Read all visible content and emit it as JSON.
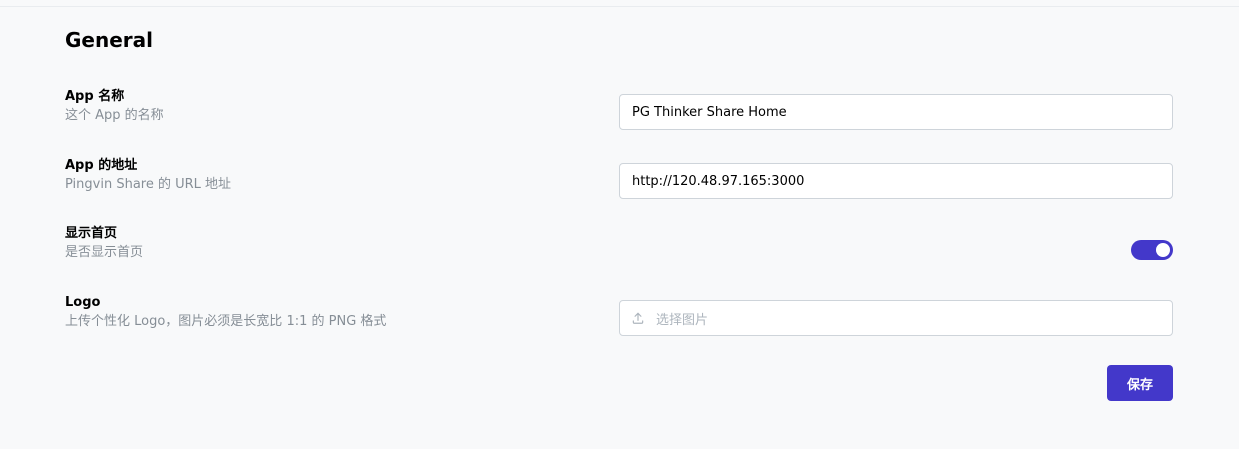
{
  "section": {
    "title": "General"
  },
  "settings": [
    {
      "title": "App 名称",
      "description": "这个 App 的名称",
      "value": "PG Thinker Share Home"
    },
    {
      "title": "App 的地址",
      "description": "Pingvin Share 的 URL 地址",
      "value": "http://120.48.97.165:3000"
    },
    {
      "title": "显示首页",
      "description": "是否显示首页",
      "enabled": true
    },
    {
      "title": "Logo",
      "description": "上传个性化 Logo，图片必须是长宽比 1:1 的 PNG 格式",
      "placeholder": "选择图片",
      "icon": "upload-icon"
    }
  ],
  "actions": {
    "save_label": "保存"
  },
  "colors": {
    "accent": "#4338ca",
    "background": "#f8f9fa",
    "muted_text": "#868e96",
    "border": "#ced4da"
  }
}
